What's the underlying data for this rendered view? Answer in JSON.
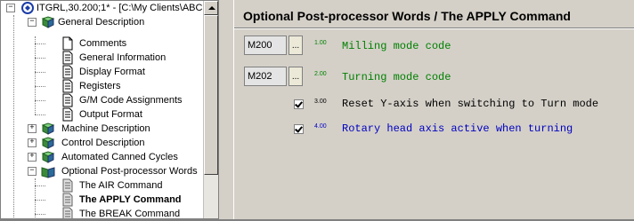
{
  "tree": {
    "root_label": "ITGRL,30.200;1* - [C:\\My Clients\\ABC",
    "items": [
      {
        "label": "General Description",
        "icon": "book-icon"
      },
      {
        "label": "Comments",
        "icon": "page-icon"
      },
      {
        "label": "General Information",
        "icon": "page-text-icon"
      },
      {
        "label": "Display Format",
        "icon": "page-text-icon"
      },
      {
        "label": "Registers",
        "icon": "page-text-icon"
      },
      {
        "label": "G/M Code Assignments",
        "icon": "page-text-icon"
      },
      {
        "label": "Output Format",
        "icon": "page-text-icon"
      },
      {
        "label": "Machine Description",
        "icon": "book-icon"
      },
      {
        "label": "Control Description",
        "icon": "book-icon"
      },
      {
        "label": "Automated Canned Cycles",
        "icon": "book-icon"
      },
      {
        "label": "Optional Post-processor Words",
        "icon": "open-book-icon"
      },
      {
        "label": "The AIR Command",
        "icon": "page-gray-icon"
      },
      {
        "label": "The APPLY Command",
        "icon": "page-gray-icon"
      },
      {
        "label": "The BREAK Command",
        "icon": "page-gray-icon"
      }
    ]
  },
  "panel": {
    "title": "Optional Post-processor Words / The APPLY Command",
    "rows": [
      {
        "code": "M200",
        "button": "...",
        "number": "1.00",
        "text": "Milling mode code",
        "color": "#008000"
      },
      {
        "code": "M202",
        "button": "...",
        "number": "2.00",
        "text": "Turning mode code",
        "color": "#008000"
      },
      {
        "number": "3.00",
        "text": "Reset Y-axis when switching to Turn mode",
        "color": "#000000",
        "checked": true
      },
      {
        "number": "4.00",
        "text": "Rotary head axis active when turning",
        "color": "#0000c0",
        "checked": true
      }
    ]
  }
}
